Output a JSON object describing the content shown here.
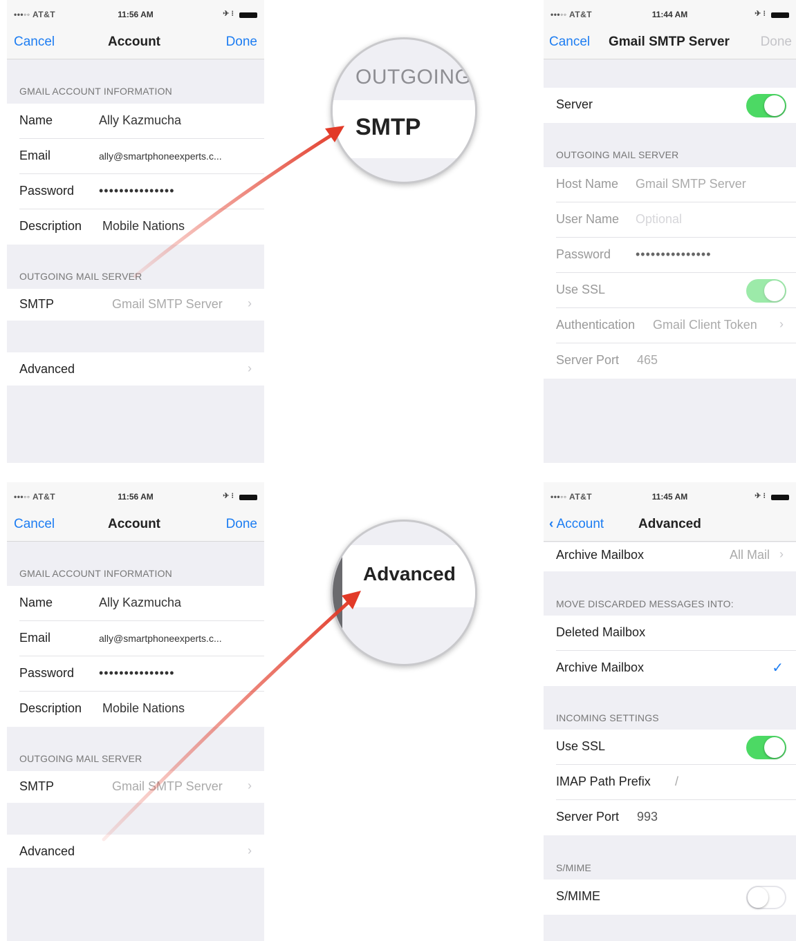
{
  "colors": {
    "accent": "#1d7df2",
    "toggle_on": "#4cd964",
    "arrow": "#e23a28",
    "group_bg": "#efeff4"
  },
  "account_screen": {
    "status": {
      "carrier": "•••◦◦ AT&T",
      "time": "11:56 AM"
    },
    "nav": {
      "cancel": "Cancel",
      "title": "Account",
      "done": "Done"
    },
    "gmail_header": "GMAIL ACCOUNT INFORMATION",
    "name_label": "Name",
    "name_value": "Ally Kazmucha",
    "email_label": "Email",
    "email_value": "ally@smartphoneexperts.c...",
    "password_label": "Password",
    "password_value": "•••••••••••••••",
    "description_label": "Description",
    "description_value": "Mobile Nations",
    "outgoing_header": "OUTGOING MAIL SERVER",
    "smtp_label": "SMTP",
    "smtp_value": "Gmail SMTP Server",
    "advanced_label": "Advanced",
    "chevron_icon": "chevron-right-icon"
  },
  "magnifier_smtp": {
    "header": "OUTGOING",
    "label": "SMTP"
  },
  "magnifier_advanced": {
    "label": "Advanced"
  },
  "smtp_screen": {
    "status": {
      "carrier": "•••◦◦ AT&T",
      "time": "11:44 AM"
    },
    "nav": {
      "cancel": "Cancel",
      "title": "Gmail SMTP Server",
      "done": "Done"
    },
    "server_label": "Server",
    "server_on": true,
    "outgoing_header": "OUTGOING MAIL SERVER",
    "host_label": "Host Name",
    "host_value": "Gmail SMTP Server",
    "user_label": "User Name",
    "user_placeholder": "Optional",
    "password_label": "Password",
    "password_value": "•••••••••••••••",
    "ssl_label": "Use SSL",
    "ssl_on": true,
    "auth_label": "Authentication",
    "auth_value": "Gmail Client Token",
    "port_label": "Server Port",
    "port_value": "465"
  },
  "advanced_screen": {
    "status": {
      "carrier": "•••◦◦ AT&T",
      "time": "11:45 AM"
    },
    "nav": {
      "back": "Account",
      "title": "Advanced"
    },
    "archive_label": "Archive Mailbox",
    "archive_value": "All Mail",
    "move_header": "MOVE DISCARDED MESSAGES INTO:",
    "deleted_label": "Deleted Mailbox",
    "archive2_label": "Archive Mailbox",
    "archive2_checked": true,
    "incoming_header": "INCOMING SETTINGS",
    "ssl_label": "Use SSL",
    "ssl_on": true,
    "imap_label": "IMAP Path Prefix",
    "imap_value": "/",
    "port_label": "Server Port",
    "port_value": "993",
    "smime_header": "S/MIME",
    "smime_label": "S/MIME",
    "smime_on": false
  }
}
